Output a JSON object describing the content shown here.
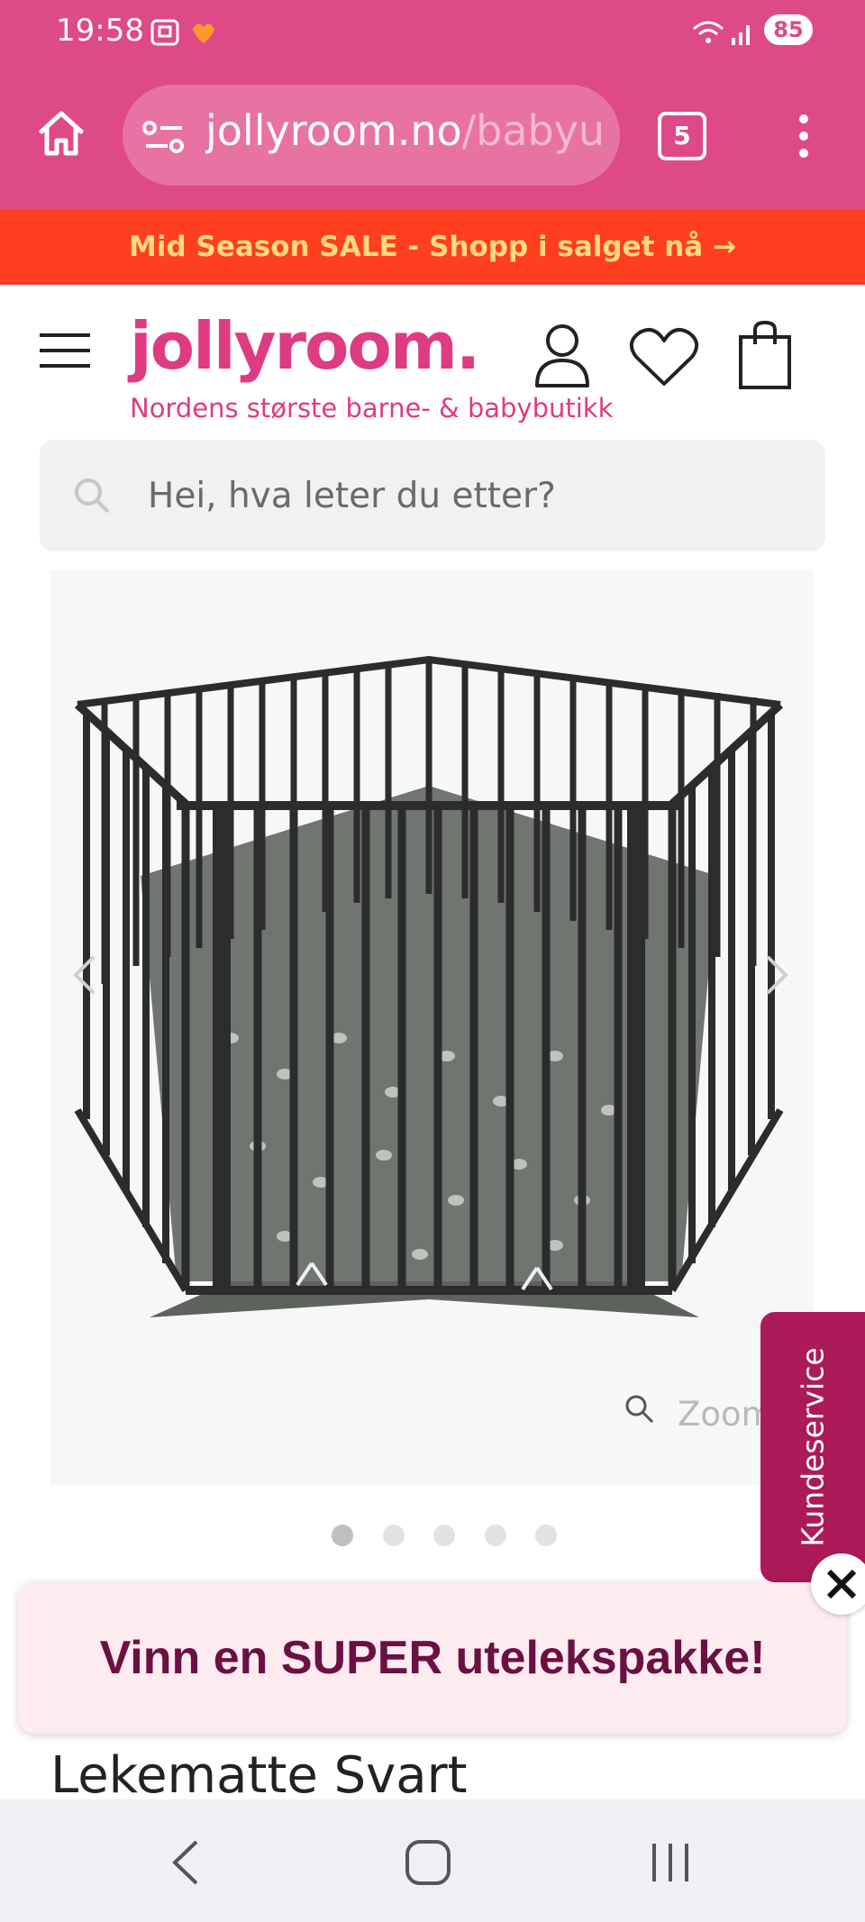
{
  "status_bar": {
    "time": "19:58",
    "battery": "85"
  },
  "browser": {
    "url_host": "jollyroom.no",
    "url_path": "/babyut",
    "tab_count": "5"
  },
  "sale_banner": "Mid Season SALE - Shopp i salget nå →",
  "site": {
    "logo": "jollyroom.",
    "tagline": "Nordens største barne- & babybutikk"
  },
  "search": {
    "placeholder": "Hei, hva leter du etter?"
  },
  "gallery": {
    "zoom_label": "Zoom",
    "dot_count": 5,
    "active_index": 0
  },
  "customer_service": "Kundeservice",
  "promo": "Vinn en SUPER utelekspakke!",
  "product": {
    "title": "Lekematte Svart"
  },
  "colors": {
    "chrome": "#de4a87",
    "sale": "#ff3f1f",
    "brand": "#de3b83",
    "customer_service": "#ad1a5a",
    "promo_text": "#6b1043"
  }
}
